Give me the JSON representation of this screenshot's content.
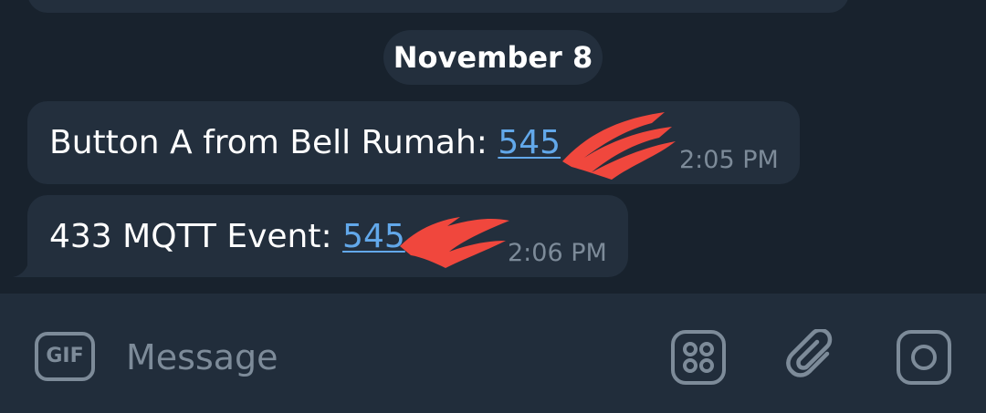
{
  "chat": {
    "date_separator": "November 8",
    "messages": [
      {
        "text": "Button A from Bell Rumah: ",
        "link": "545",
        "time": "2:05 PM"
      },
      {
        "text": "433 MQTT Event: ",
        "link": "545",
        "time": "2:06 PM"
      }
    ]
  },
  "composer": {
    "gif_label": "GIF",
    "placeholder": "Message",
    "icons": [
      "sticker-grid-icon",
      "paperclip-icon",
      "camera-icon"
    ]
  },
  "colors": {
    "background": "#18222d",
    "bubble": "#232f3d",
    "composer": "#212d3b",
    "link": "#62a8ea",
    "muted": "#7d8b99",
    "redaction": "#f0473d"
  }
}
